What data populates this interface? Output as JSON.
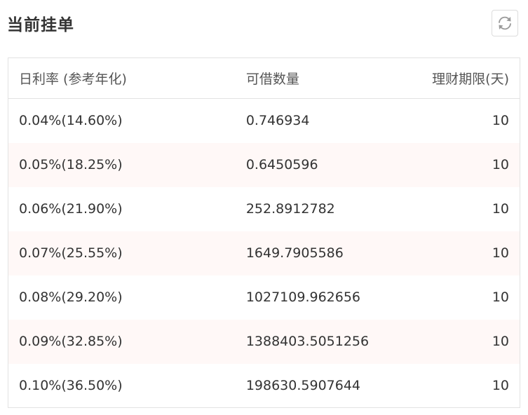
{
  "header": {
    "title": "当前挂单",
    "refresh_icon": "refresh-icon"
  },
  "table": {
    "columns": {
      "rate": "日利率 (参考年化)",
      "amount": "可借数量",
      "term": "理财期限(天)"
    },
    "rows": [
      {
        "rate": "0.04%(14.60%)",
        "amount": "0.746934",
        "term": "10"
      },
      {
        "rate": "0.05%(18.25%)",
        "amount": "0.6450596",
        "term": "10"
      },
      {
        "rate": "0.06%(21.90%)",
        "amount": "252.8912782",
        "term": "10"
      },
      {
        "rate": "0.07%(25.55%)",
        "amount": "1649.7905586",
        "term": "10"
      },
      {
        "rate": "0.08%(29.20%)",
        "amount": "1027109.962656",
        "term": "10"
      },
      {
        "rate": "0.09%(32.85%)",
        "amount": "1388403.5051256",
        "term": "10"
      },
      {
        "rate": "0.10%(36.50%)",
        "amount": "198630.5907644",
        "term": "10"
      }
    ]
  },
  "colors": {
    "row_stripe": "#fff8f7",
    "border": "#e2e2e2",
    "text": "#333333"
  }
}
